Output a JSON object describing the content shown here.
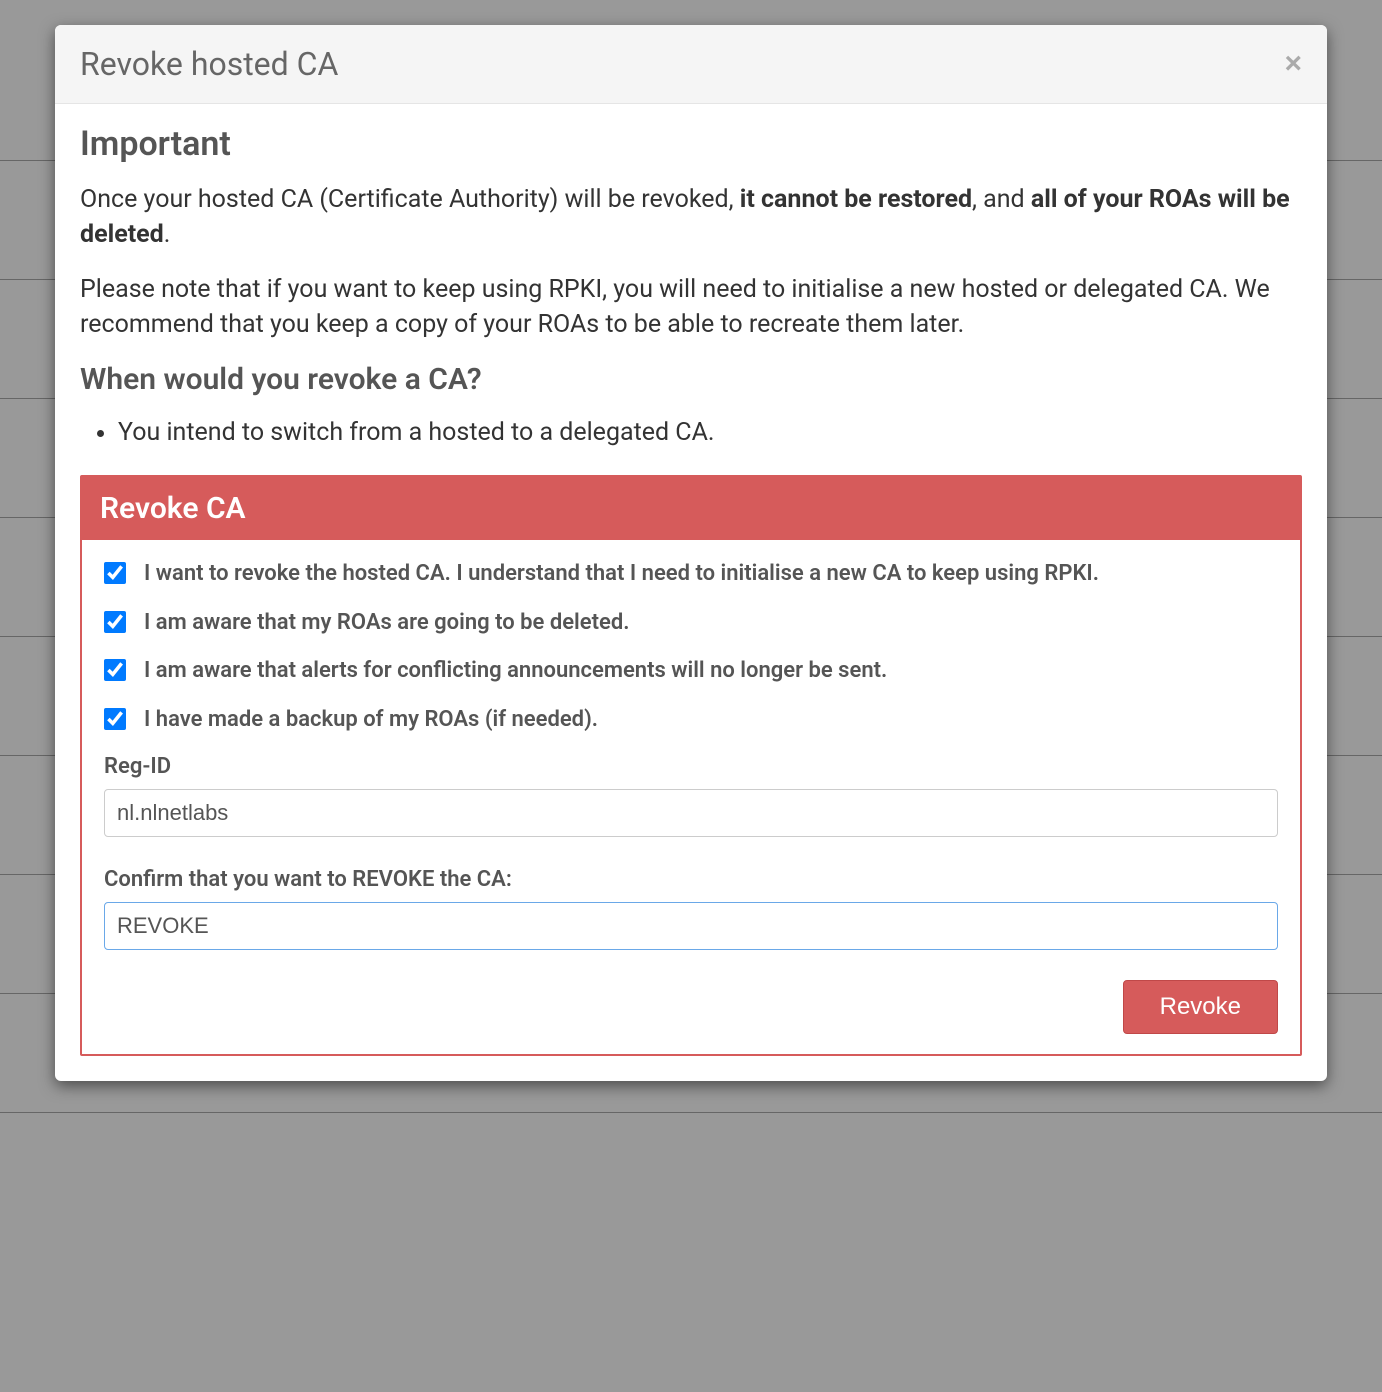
{
  "modal": {
    "title": "Revoke hosted CA",
    "importantHeading": "Important",
    "para1_prefix": "Once your hosted CA (Certificate Authority) will be revoked, ",
    "para1_bold1": "it cannot be restored",
    "para1_mid": ", and ",
    "para1_bold2": "all of your ROAs will be deleted",
    "para1_suffix": ".",
    "para2": "Please note that if you want to keep using RPKI, you will need to initialise a new hosted or delegated CA. We recommend that you keep a copy of your ROAs to be able to recreate them later.",
    "whenHeading": "When would you revoke a CA?",
    "bullets": [
      "You intend to switch from a hosted to a delegated CA."
    ],
    "panel": {
      "header": "Revoke CA",
      "checkboxes": [
        "I want to revoke the hosted CA. I understand that I need to initialise a new CA to keep using RPKI.",
        "I am aware that my ROAs are going to be deleted.",
        "I am aware that alerts for conflicting announcements will no longer be sent.",
        "I have made a backup of my ROAs (if needed)."
      ],
      "regIdLabel": "Reg-ID",
      "regIdValue": "nl.nlnetlabs",
      "confirmLabel": "Confirm that you want to REVOKE the CA:",
      "confirmValue": "REVOKE",
      "revokeButton": "Revoke"
    }
  }
}
